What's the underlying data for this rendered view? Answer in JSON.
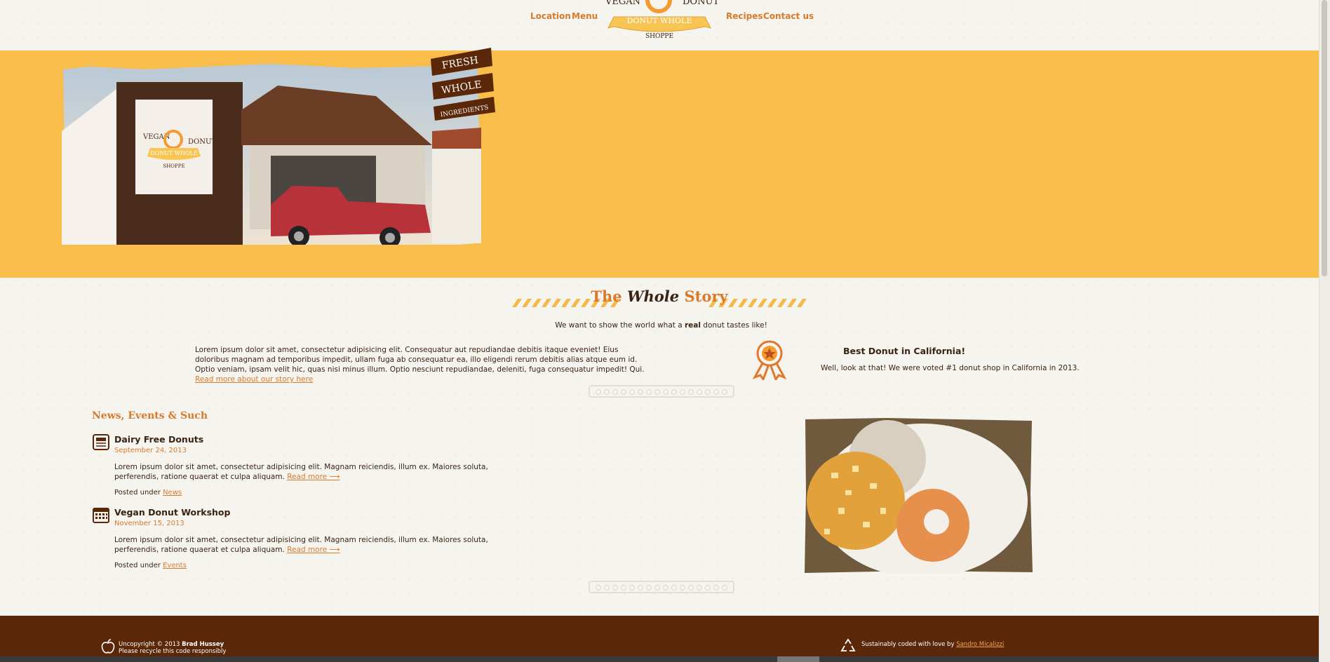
{
  "nav": {
    "left": [
      "Location",
      "Menu"
    ],
    "right": [
      "Recipes",
      "Contact us"
    ]
  },
  "logo": {
    "top_left": "VEGAN",
    "top_right": "DONUT",
    "ribbon": "DONUT WHOLE",
    "bottom": "SHOPPE"
  },
  "hero": {
    "banner": [
      "FRESH",
      "WHOLE",
      "INGREDIENTS"
    ],
    "sign": {
      "left": "VEGAN",
      "right": "DONUT",
      "ribbon": "DONUT WHOLE",
      "bottom": "SHOPPE"
    }
  },
  "story": {
    "title_pre": "The ",
    "title_em": "Whole",
    "title_post": " Story",
    "tagline_pre": "We want to show the world what a ",
    "tagline_bold": "real",
    "tagline_post": " donut tastes like!",
    "text": "Lorem ipsum dolor sit amet, consectetur adipisicing elit. Consequatur aut repudiandae debitis itaque eveniet! Eius doloribus magnam ad temporibus impedit, ullam fuga ab consequatur ea, illo eligendi rerum debitis alias atque eum id. Optio veniam, ipsam velit hic, quas nisi minus illum. Optio nesciunt repudiandae, deleniti, fuga consequatur impedit! Qui. ",
    "link": "Read more about our story here"
  },
  "award": {
    "title": "Best Donut in California!",
    "text": "Well, look at that! We were voted #1 donut shop in California in 2013."
  },
  "news": {
    "title": "News, Events & Such",
    "posts": [
      {
        "icon": "news-icon",
        "title": "Dairy Free Donuts",
        "date": "September 24, 2013",
        "body": "Lorem ipsum dolor sit amet, consectetur adipisicing elit. Magnam reiciendis, illum ex. Maiores soluta, perferendis, ratione quaerat et culpa aliquam. ",
        "more": "Read more ⟶",
        "posted": "Posted under ",
        "category": "News"
      },
      {
        "icon": "calendar-icon",
        "title": "Vegan Donut Workshop",
        "date": "November 15, 2013",
        "body": "Lorem ipsum dolor sit amet, consectetur adipisicing elit. Magnam reiciendis, illum ex. Maiores soluta, perferendis, ratione quaerat et culpa aliquam. ",
        "more": "Read more ⟶",
        "posted": "Posted under ",
        "category": "Events"
      }
    ]
  },
  "footer": {
    "copy_pre": "Uncopyright © 2013 ",
    "copy_name": "Brad Hussey",
    "copy_line2": "Please recycle this code responsibly",
    "sust_pre": "Sustainably coded with love by ",
    "sust_link": "Sandro Micalizzi"
  },
  "colors": {
    "accent": "#d97a2b",
    "hero_bg": "#f8bd4b",
    "footer_bg": "#5a2709",
    "text": "#3b2314"
  }
}
